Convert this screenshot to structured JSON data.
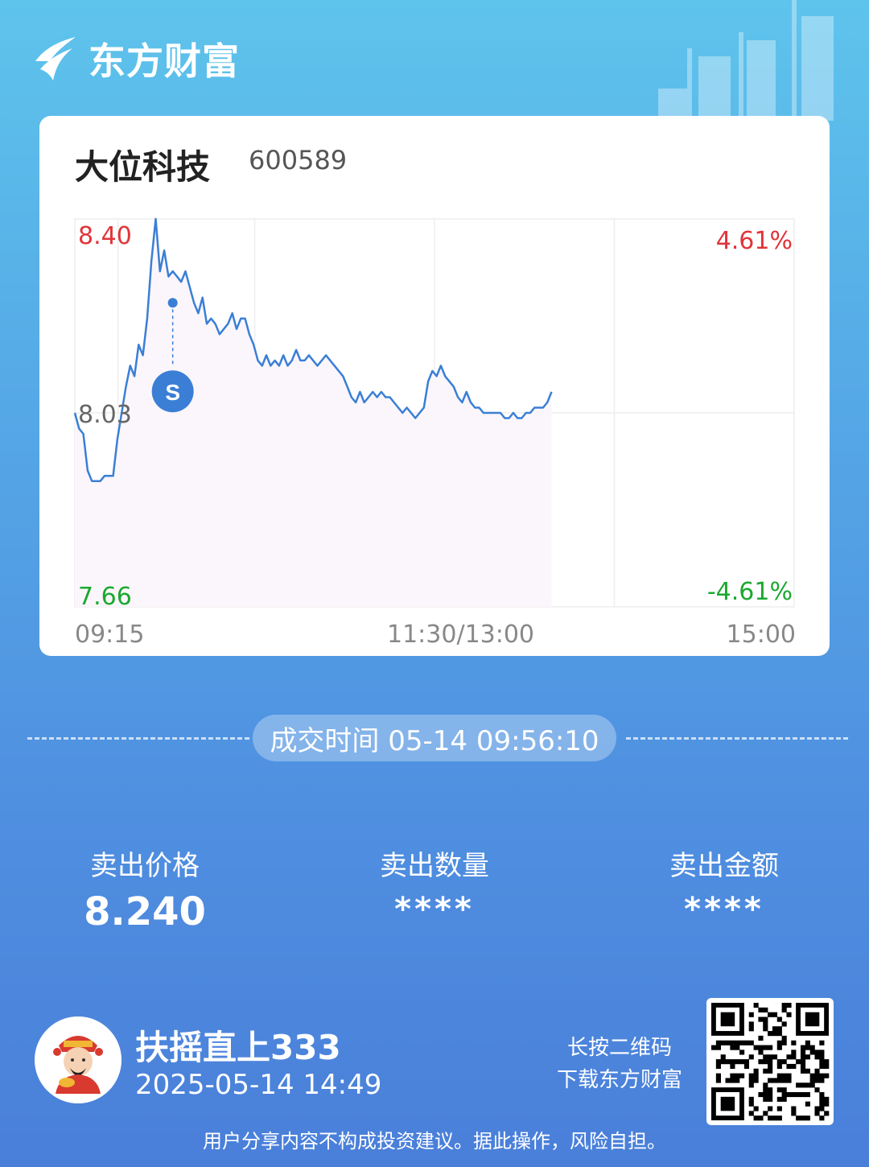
{
  "brand": {
    "name": "东方财富"
  },
  "stock": {
    "name": "大位科技",
    "code": "600589"
  },
  "chart_data": {
    "type": "line",
    "title": "",
    "y_high_label": "8.40",
    "y_mid_label": "8.03",
    "y_low_label": "7.66",
    "pct_high_label": "4.61%",
    "pct_low_label": "-4.61%",
    "x_start_label": "09:15",
    "x_mid_label": "11:30/13:00",
    "x_end_label": "15:00",
    "ylim": [
      7.66,
      8.4
    ],
    "prev_close": 8.03,
    "series": [
      {
        "values": [
          8.03,
          8.0,
          7.99,
          7.92,
          7.9,
          7.9,
          7.9,
          7.91,
          7.91,
          7.91,
          7.98,
          8.03,
          8.08,
          8.12,
          8.1,
          8.16,
          8.14,
          8.21,
          8.32,
          8.4,
          8.3,
          8.34,
          8.29,
          8.3,
          8.29,
          8.28,
          8.3,
          8.27,
          8.24,
          8.22,
          8.25,
          8.2,
          8.21,
          8.2,
          8.18,
          8.19,
          8.2,
          8.22,
          8.19,
          8.21,
          8.21,
          8.18,
          8.16,
          8.13,
          8.12,
          8.14,
          8.12,
          8.13,
          8.12,
          8.14,
          8.12,
          8.13,
          8.15,
          8.13,
          8.13,
          8.14,
          8.13,
          8.12,
          8.13,
          8.14,
          8.13,
          8.12,
          8.11,
          8.1,
          8.08,
          8.06,
          8.05,
          8.07,
          8.05,
          8.06,
          8.07,
          8.06,
          8.07,
          8.06,
          8.06,
          8.05,
          8.04,
          8.03,
          8.04,
          8.03,
          8.02,
          8.03,
          8.04,
          8.09,
          8.11,
          8.1,
          8.12,
          8.1,
          8.09,
          8.08,
          8.06,
          8.05,
          8.07,
          8.05,
          8.04,
          8.04,
          8.03,
          8.03,
          8.03,
          8.03,
          8.03,
          8.02,
          8.02,
          8.03,
          8.02,
          8.02,
          8.03,
          8.03,
          8.04,
          8.04,
          8.04,
          8.05,
          8.07
        ]
      }
    ],
    "trade_marker": {
      "label": "S",
      "index": 23,
      "price": 8.24
    }
  },
  "trade": {
    "time_label": "成交时间 05-14 09:56:10"
  },
  "stats": [
    {
      "label": "卖出价格",
      "value": "8.240"
    },
    {
      "label": "卖出数量",
      "value": "****"
    },
    {
      "label": "卖出金额",
      "value": "****"
    }
  ],
  "user": {
    "name": "扶摇直上333",
    "time": "2025-05-14 14:49"
  },
  "qr": {
    "hint_line1": "长按二维码",
    "hint_line2": "下载东方财富"
  },
  "disclaimer": "用户分享内容不构成投资建议。据此操作，风险自担。",
  "colors": {
    "up": "#e0343a",
    "down": "#1aa82f",
    "line": "#3a7fd5",
    "fill": "#fbf6fb",
    "grid": "#eeeeee"
  }
}
